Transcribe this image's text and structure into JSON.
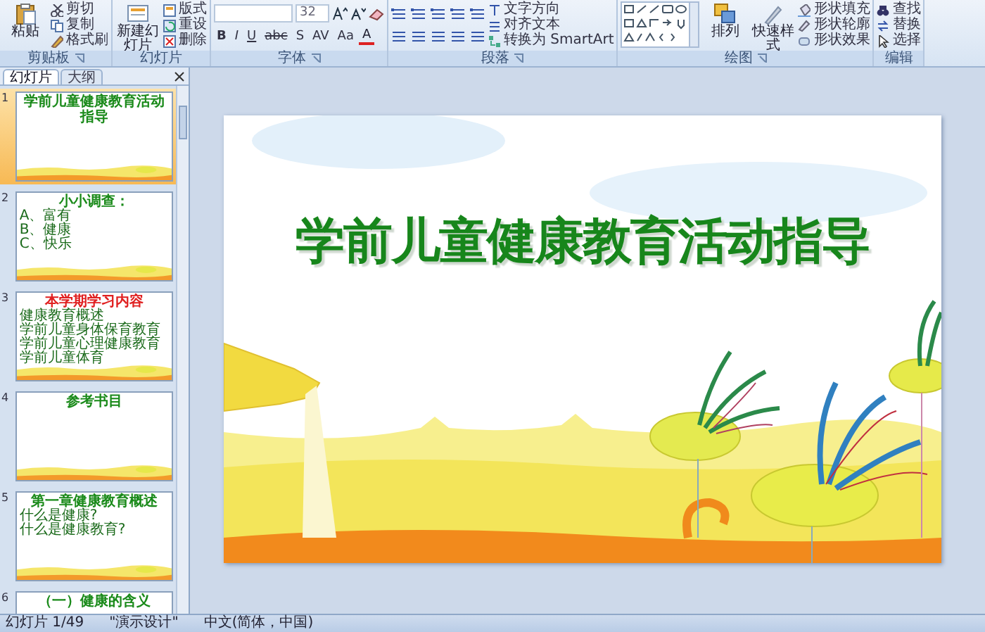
{
  "ribbon": {
    "groups": [
      {
        "label": "剪贴板",
        "has_launcher": true,
        "large": [
          {
            "label": "粘贴"
          }
        ],
        "small": [
          {
            "label": "剪切"
          },
          {
            "label": "复制"
          },
          {
            "label": "格式刷"
          }
        ]
      },
      {
        "label": "幻灯片",
        "has_launcher": false,
        "large": [
          {
            "label": "新建幻灯片"
          }
        ],
        "small": [
          {
            "label": "版式"
          },
          {
            "label": "重设"
          },
          {
            "label": "删除"
          }
        ]
      },
      {
        "label": "字体",
        "has_launcher": true,
        "font_size": "32",
        "format_buttons": [
          "B",
          "I",
          "U",
          "abc",
          "S",
          "AV",
          "Aa",
          "A"
        ]
      },
      {
        "label": "段落",
        "has_launcher": true,
        "small": [
          {
            "label": "文字方向"
          },
          {
            "label": "对齐文本"
          },
          {
            "label": "转换为 SmartArt"
          }
        ]
      },
      {
        "label": "绘图",
        "has_launcher": true,
        "large": [
          {
            "label": "排列"
          },
          {
            "label": "快速样式"
          }
        ],
        "small": [
          {
            "label": "形状填充"
          },
          {
            "label": "形状轮廓"
          },
          {
            "label": "形状效果"
          }
        ]
      },
      {
        "label": "编辑",
        "has_launcher": false,
        "small": [
          {
            "label": "查找"
          },
          {
            "label": "替换"
          },
          {
            "label": "选择"
          }
        ]
      }
    ]
  },
  "panel_tabs": [
    {
      "label": "幻灯片",
      "selected": true
    },
    {
      "label": "大纲",
      "selected": false
    }
  ],
  "slides": [
    {
      "number": "1",
      "selected": true,
      "title": "学前儿童健康教育活动指导",
      "color": "#1a8a1a"
    },
    {
      "number": "2",
      "selected": false,
      "title": "小小调查：",
      "color": "#1a8a1a",
      "bullets": [
        "A、富有",
        "B、健康",
        "C、快乐"
      ]
    },
    {
      "number": "3",
      "selected": false,
      "title": "本学期学习内容",
      "color": "#e02020",
      "bullets": [
        "健康教育概述",
        "学前儿童身体保育教育",
        "学前儿童心理健康教育",
        "学前儿童体育"
      ]
    },
    {
      "number": "4",
      "selected": false,
      "title": "参考书目",
      "color": "#1a8a1a"
    },
    {
      "number": "5",
      "selected": false,
      "title": "第一章健康教育概述",
      "color": "#1a8a1a",
      "bullets": [
        "什么是健康?",
        "什么是健康教育?"
      ]
    },
    {
      "number": "6",
      "selected": false,
      "title": "（一）健康的含义",
      "color": "#1a8a1a"
    }
  ],
  "slide": {
    "title": "学前儿童健康教育活动指导"
  },
  "status_bar": [
    "幻灯片 1/49",
    "\"演示设计\"",
    "中文(简体，中国)"
  ]
}
